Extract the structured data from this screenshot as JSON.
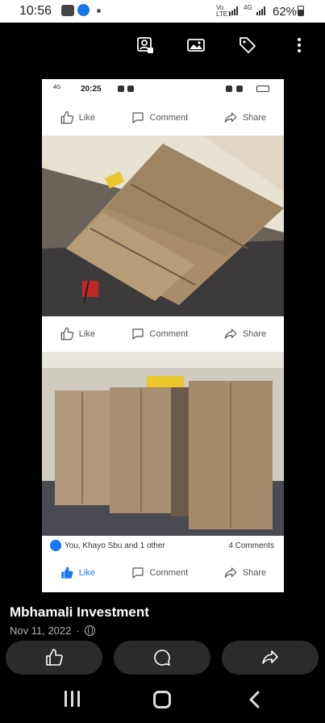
{
  "status_bar": {
    "time": "10:56",
    "net1": "Vo\nLTE1",
    "net2": "4G",
    "battery": "62%"
  },
  "viewer_actions": [
    "tag-photo-icon",
    "gallery-icon",
    "tag-icon",
    "more-icon"
  ],
  "embedded_screenshot": {
    "status": {
      "time": "20:25",
      "network": "4G"
    },
    "action_labels": {
      "like": "Like",
      "comment": "Comment",
      "share": "Share"
    },
    "reactions": {
      "names": "You, Khayo Sbu and 1 other",
      "comments": "4 Comments"
    }
  },
  "post": {
    "author": "Mbhamali Investment",
    "date": "Nov 11, 2022",
    "separator": "·"
  },
  "bottom_actions": [
    "like-icon",
    "comment-icon",
    "share-icon"
  ],
  "colors": {
    "facebook_blue": "#1877f2",
    "pill_bg": "#2a2b2d"
  }
}
